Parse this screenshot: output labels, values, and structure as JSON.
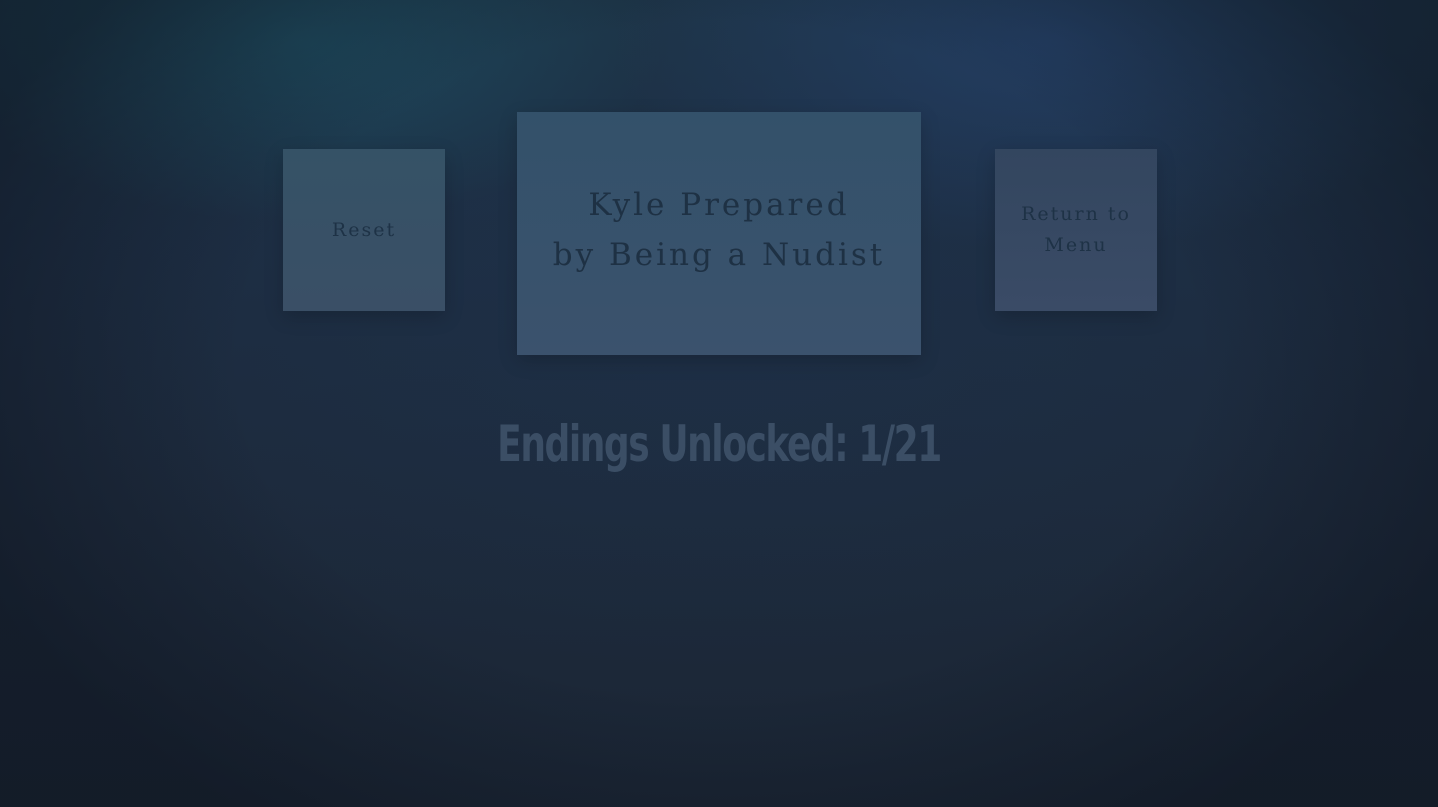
{
  "buttons": {
    "reset_label": "Reset",
    "menu_label_line1": "Return to",
    "menu_label_line2": "Menu"
  },
  "ending": {
    "title_line1": "Kyle Prepared",
    "title_line2": "by Being a Nudist"
  },
  "progress": {
    "label": "Endings Unlocked: 1/21",
    "unlocked": 1,
    "total": 21
  },
  "colors": {
    "background": "#1c2838",
    "card": "#3a5068",
    "card_text": "#1e3144",
    "counter_text": "#3b4e65"
  }
}
